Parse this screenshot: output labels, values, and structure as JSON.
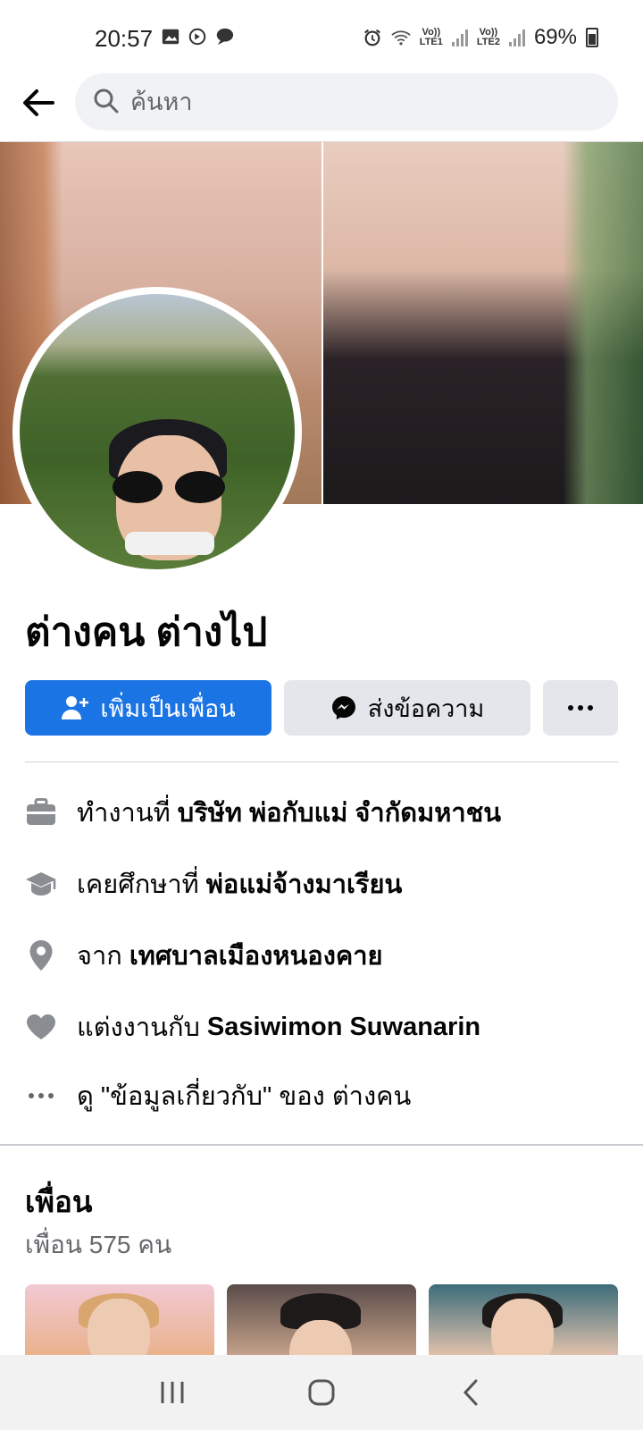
{
  "status_bar": {
    "time": "20:57",
    "battery": "69%",
    "sim1": "LTE1",
    "sim2": "LTE2",
    "volte": "Vo))"
  },
  "header": {
    "search_placeholder": "ค้นหา"
  },
  "profile": {
    "name": "ต่างคน ต่างไป"
  },
  "actions": {
    "add_friend_label": "เพิ่มเป็นเพื่อน",
    "message_label": "ส่งข้อความ",
    "more_label": "···"
  },
  "intro": [
    {
      "icon": "briefcase-icon",
      "prefix": "ทำงานที่",
      "value": "บริษัท พ่อกับแม่ จำกัดมหาชน"
    },
    {
      "icon": "graduation-cap-icon",
      "prefix": "เคยศึกษาที่",
      "value": "พ่อแม่จ้างมาเรียน"
    },
    {
      "icon": "location-pin-icon",
      "prefix": "จาก",
      "value": "เทศบาลเมืองหนองคาย"
    },
    {
      "icon": "heart-icon",
      "prefix": "แต่งงานกับ",
      "value": "Sasiwimon Suwanarin"
    },
    {
      "icon": "more-dots-icon",
      "prefix": "ดู \"ข้อมูลเกี่ยวกับ\" ของ ต่างคน",
      "value": ""
    }
  ],
  "friends": {
    "title": "เพื่อน",
    "count": "เพื่อน 575 คน"
  },
  "colors": {
    "primary": "#1b74e4",
    "secondary_button": "#e4e6eb",
    "search_bg": "#f0f2f5",
    "muted_text": "#65676b"
  }
}
